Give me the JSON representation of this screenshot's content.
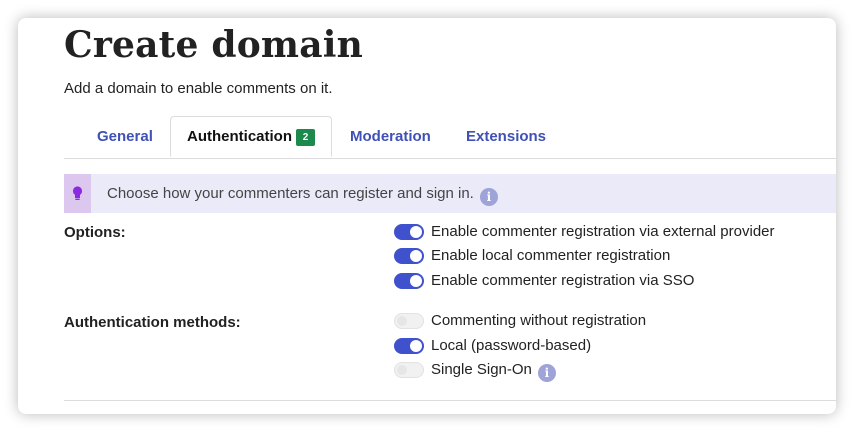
{
  "page": {
    "title": "Create domain",
    "subtitle": "Add a domain to enable comments on it."
  },
  "tabs": [
    {
      "label": "General",
      "active": false
    },
    {
      "label": "Authentication",
      "active": true,
      "badge": "2"
    },
    {
      "label": "Moderation",
      "active": false
    },
    {
      "label": "Extensions",
      "active": false
    }
  ],
  "hint": {
    "icon": "lightbulb-icon",
    "text": "Choose how your commenters can register and sign in.",
    "info_icon": "info-icon"
  },
  "options": {
    "label": "Options:",
    "items": [
      {
        "label": "Enable commenter registration via external provider",
        "enabled": true
      },
      {
        "label": "Enable local commenter registration",
        "enabled": true
      },
      {
        "label": "Enable commenter registration via SSO",
        "enabled": true
      }
    ]
  },
  "auth_methods": {
    "label": "Authentication methods:",
    "items": [
      {
        "label": "Commenting without registration",
        "enabled": false
      },
      {
        "label": "Local (password-based)",
        "enabled": true
      },
      {
        "label": "Single Sign-On",
        "enabled": false,
        "info_icon": "info-icon"
      }
    ]
  },
  "colors": {
    "accent": "#3f51cc",
    "tab_link": "#3f51b5",
    "badge": "#1b8a4c",
    "hint_bg": "#eaeaf9",
    "hint_icon_bg": "#dcc8ef",
    "lightbulb": "#8a2be2"
  }
}
